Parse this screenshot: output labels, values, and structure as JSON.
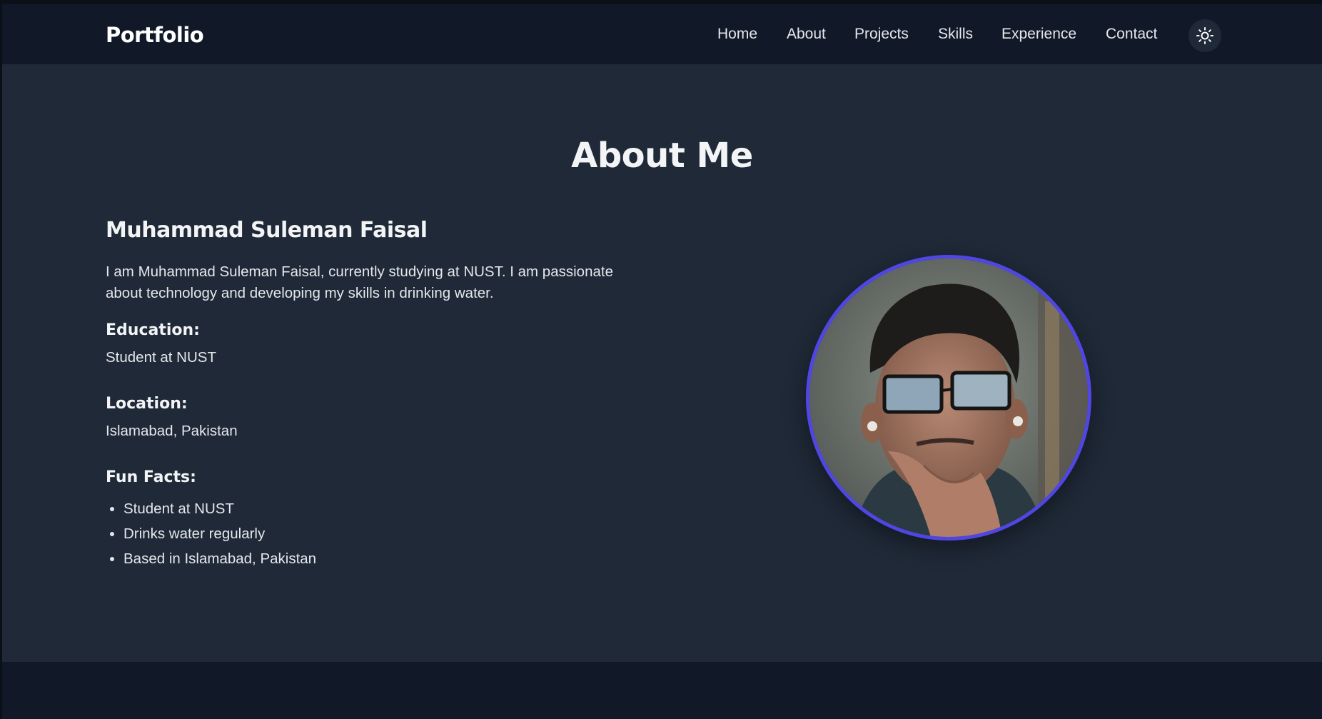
{
  "nav": {
    "brand": "Portfolio",
    "links": [
      {
        "label": "Home"
      },
      {
        "label": "About"
      },
      {
        "label": "Projects"
      },
      {
        "label": "Skills"
      },
      {
        "label": "Experience"
      },
      {
        "label": "Contact"
      }
    ],
    "theme_toggle_icon": "sun-icon"
  },
  "about": {
    "title": "About Me",
    "name": "Muhammad Suleman Faisal",
    "bio": "I am Muhammad Suleman Faisal, currently studying at NUST. I am passionate about technology and developing my skills in drinking water.",
    "education_heading": "Education:",
    "education_value": "Student at NUST",
    "location_heading": "Location:",
    "location_value": "Islamabad, Pakistan",
    "fun_facts_heading": "Fun Facts:",
    "fun_facts": [
      "Student at NUST",
      "Drinks water regularly",
      "Based in Islamabad, Pakistan"
    ]
  },
  "colors": {
    "navbar_bg": "#111827",
    "section_bg": "#1f2937",
    "avatar_ring": "#4f46e5"
  }
}
